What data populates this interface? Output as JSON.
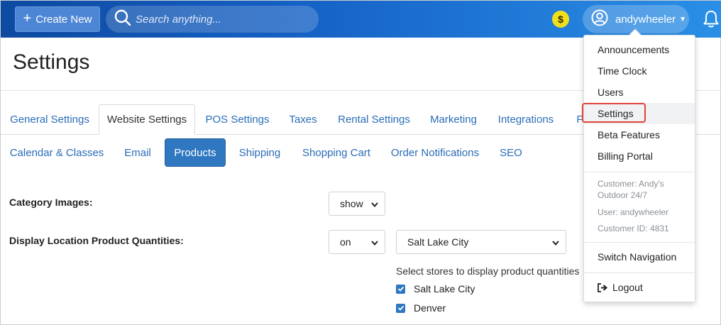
{
  "header": {
    "create_label": "Create New",
    "search_placeholder": "Search anything...",
    "coin_symbol": "$",
    "username": "andywheeler"
  },
  "page": {
    "title": "Settings"
  },
  "main_tabs": [
    {
      "label": "General Settings"
    },
    {
      "label": "Website Settings",
      "active": true
    },
    {
      "label": "POS Settings"
    },
    {
      "label": "Taxes"
    },
    {
      "label": "Rental Settings"
    },
    {
      "label": "Marketing"
    },
    {
      "label": "Integrations"
    },
    {
      "label": "F"
    }
  ],
  "sub_tabs": [
    {
      "label": "Calendar & Classes"
    },
    {
      "label": "Email"
    },
    {
      "label": "Products",
      "active": true
    },
    {
      "label": "Shipping"
    },
    {
      "label": "Shopping Cart"
    },
    {
      "label": "Order Notifications"
    },
    {
      "label": "SEO"
    }
  ],
  "form": {
    "category_images": {
      "label": "Category Images:",
      "value": "show"
    },
    "location_quantities": {
      "label": "Display Location Product Quantities:",
      "toggle_value": "on",
      "store_value": "Salt Lake City",
      "help": "Select stores to display product quantities",
      "stores": [
        {
          "name": "Salt Lake City",
          "checked": true
        },
        {
          "name": "Denver",
          "checked": true
        }
      ]
    }
  },
  "user_menu": {
    "items": [
      "Announcements",
      "Time Clock",
      "Users",
      "Settings",
      "Beta Features",
      "Billing Portal"
    ],
    "customer": "Customer: Andy's Outdoor 24/7",
    "user": "User: andywheeler",
    "customer_id": "Customer ID: 4831",
    "switch_navigation": "Switch Navigation",
    "logout": "Logout"
  },
  "colors": {
    "header_start": "#0d4aa0",
    "header_end": "#2a8fe6",
    "accent": "#2f78c1",
    "link": "#2a6cb6",
    "highlight_outline": "#e0443a",
    "coin": "#f2df1c"
  }
}
